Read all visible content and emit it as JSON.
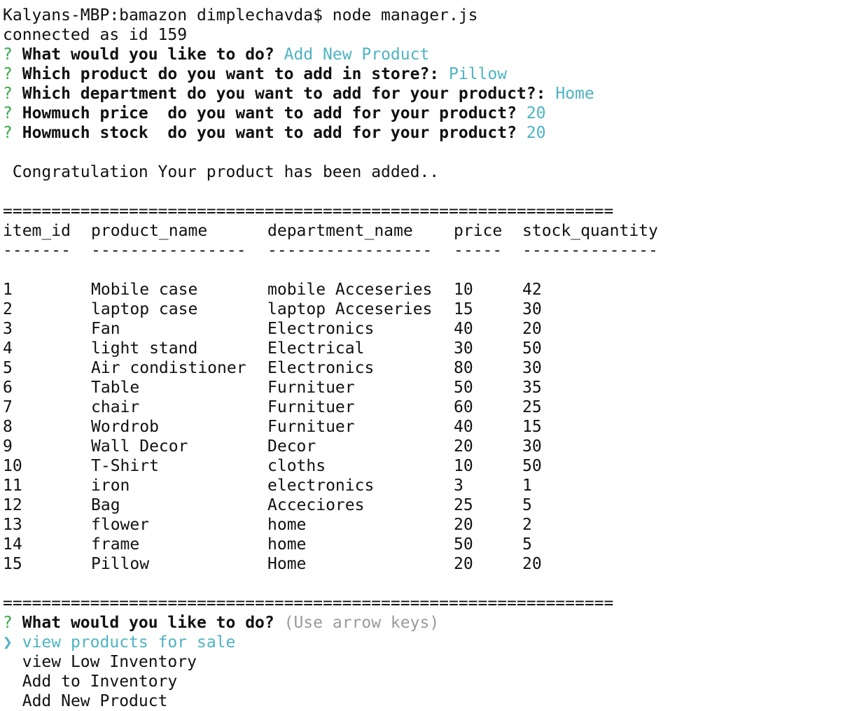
{
  "terminal": {
    "command_line": "Kalyans-MBP:bamazon dimplechavda$ node manager.js",
    "connected_line": "connected as id 159",
    "prompt_symbol": "?",
    "q1": {
      "question": "What would you like to do?",
      "answer": "Add New Product"
    },
    "q2": {
      "question": "Which product do you want to add in store?:",
      "answer": "Pillow"
    },
    "q3": {
      "question": "Which department do you want to add for your product?:",
      "answer": "Home"
    },
    "q4": {
      "question": "Howmuch price  do you want to add for your product?",
      "answer": "20"
    },
    "q5": {
      "question": "Howmuch stock  do you want to add for your product?",
      "answer": "20"
    },
    "success_message": " Congratulation Your product has been added..",
    "separator": "===============================================================",
    "table": {
      "headers": [
        "item_id",
        "product_name",
        "department_name",
        "price",
        "stock_quantity"
      ],
      "header_rules": [
        "-------",
        "----------------",
        "-----------------",
        "-----",
        "--------------"
      ],
      "rows": [
        [
          "1",
          "Mobile case",
          "mobile Acceseries",
          "10",
          "42"
        ],
        [
          "2",
          "laptop case",
          "laptop Acceseries",
          "15",
          "30"
        ],
        [
          "3",
          "Fan",
          "Electronics",
          "40",
          "20"
        ],
        [
          "4",
          "light stand",
          "Electrical",
          "30",
          "50"
        ],
        [
          "5",
          "Air condistioner",
          "Electronics",
          "80",
          "30"
        ],
        [
          "6",
          "Table",
          "Furnituer",
          "50",
          "35"
        ],
        [
          "7",
          "chair",
          "Furnituer",
          "60",
          "25"
        ],
        [
          "8",
          "Wordrob",
          "Furnituer",
          "40",
          "15"
        ],
        [
          "9",
          "Wall Decor",
          "Decor",
          "20",
          "30"
        ],
        [
          "10",
          "T-Shirt",
          "cloths",
          "10",
          "50"
        ],
        [
          "11",
          "iron",
          "electronics",
          "3",
          "1"
        ],
        [
          "12",
          "Bag",
          "Acceciores",
          "25",
          "5"
        ],
        [
          "13",
          "flower",
          "home",
          "20",
          "2"
        ],
        [
          "14",
          "frame",
          "home",
          "50",
          "5"
        ],
        [
          "15",
          "Pillow",
          "Home",
          "20",
          "20"
        ]
      ]
    },
    "menu": {
      "question": "What would you like to do?",
      "hint": "(Use arrow keys)",
      "pointer": "❯",
      "options": [
        "view products for sale",
        "view Low Inventory",
        "Add to Inventory",
        "Add New Product"
      ],
      "selected_index": 0
    }
  },
  "colors": {
    "prompt_symbol": "#36a94a",
    "answer": "#4fb3c1",
    "hint": "#9a9a9a",
    "text": "#111111",
    "background": "#ffffff"
  }
}
